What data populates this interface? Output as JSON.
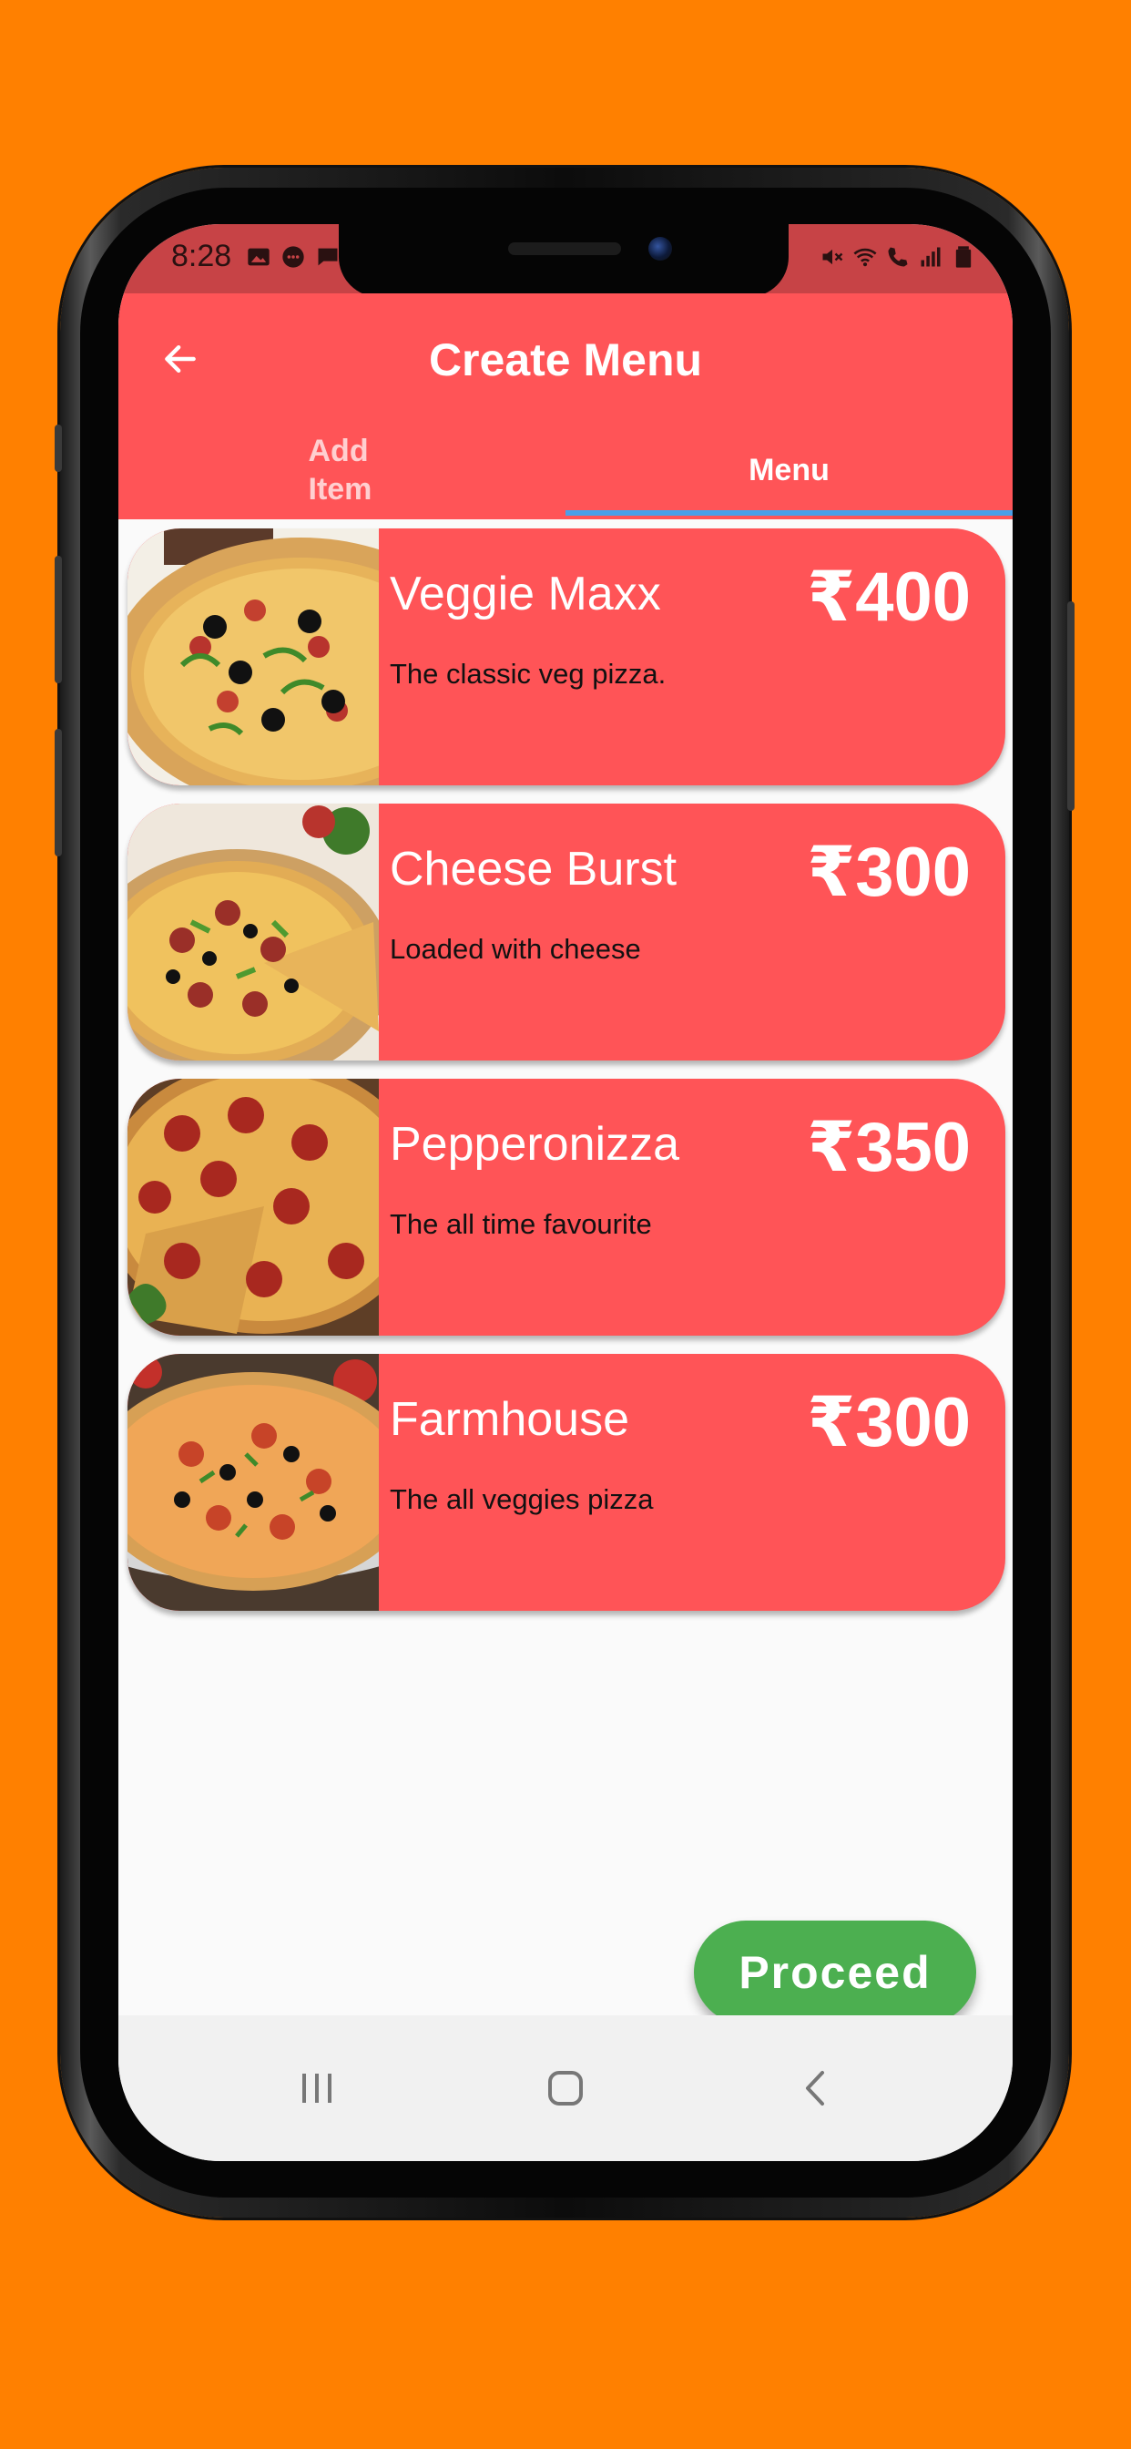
{
  "status_bar": {
    "time": "8:28",
    "left_icons": [
      "image-icon",
      "message-icon",
      "chat-icon"
    ],
    "right_icons": [
      "mute-icon",
      "wifi-icon",
      "wifi-call-icon",
      "signal-icon",
      "battery-icon"
    ]
  },
  "app_bar": {
    "title": "Create Menu",
    "back_icon": "arrow-left-icon"
  },
  "tabs": [
    {
      "label": "Add Item",
      "selected": false
    },
    {
      "label": "Menu",
      "selected": true
    }
  ],
  "menu_items": [
    {
      "name": "Veggie Maxx",
      "price": "₹400",
      "description": "The classic veg pizza.",
      "image": "veg-pizza-image"
    },
    {
      "name": "Cheese Burst",
      "price": "₹300",
      "description": "Loaded with cheese",
      "image": "cheese-pizza-image"
    },
    {
      "name": "Pepperonizza",
      "price": "₹350",
      "description": "The all time favourite",
      "image": "pepperoni-pizza-image"
    },
    {
      "name": "Farmhouse",
      "price": "₹300",
      "description": "The all veggies pizza",
      "image": "farmhouse-pizza-image"
    }
  ],
  "proceed_button": {
    "label": "Proceed"
  },
  "nav_bar": {
    "icons": [
      "recent-apps-icon",
      "home-icon",
      "back-icon"
    ]
  },
  "colors": {
    "background": "#ff8000",
    "app_bar": "#ff5457",
    "status_bar": "#c74346",
    "card": "#ff5457",
    "tab_indicator": "#4a9fe8",
    "proceed_button": "#4caf50"
  }
}
